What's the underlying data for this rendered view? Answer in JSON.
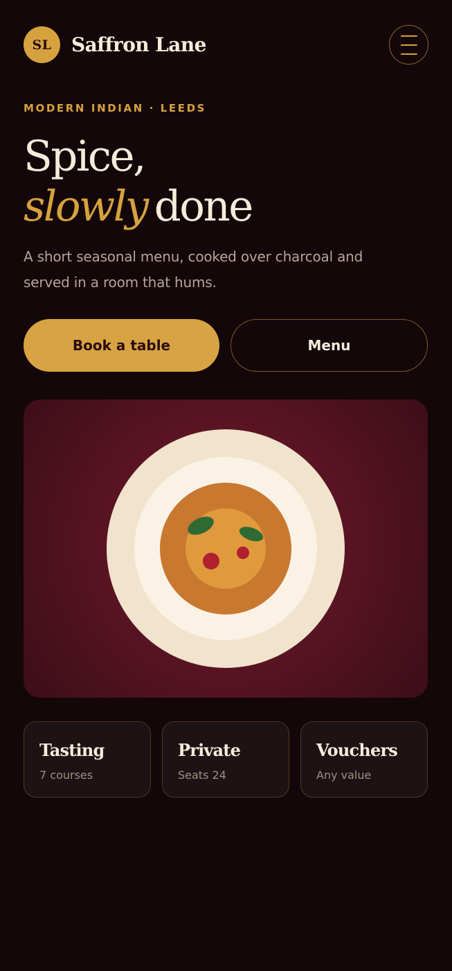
{
  "brand": {
    "logo_initials": "SL",
    "name": "Saffron Lane"
  },
  "header": {
    "menu_icon": "hamburger-menu-icon"
  },
  "hero": {
    "eyebrow": "MODERN INDIAN · LEEDS",
    "headline_line1": "Spice,",
    "headline_accent": "slowly",
    "headline_line2_rest": "done",
    "lead": "A short seasonal menu, cooked over charcoal and served in a room that hums.",
    "image_icon": "curry-plate-illustration"
  },
  "actions": {
    "primary_label": "Book a table",
    "secondary_label": "Menu"
  },
  "cards": [
    {
      "title": "Tasting",
      "subtitle": "7 courses"
    },
    {
      "title": "Private",
      "subtitle": "Seats 24"
    },
    {
      "title": "Vouchers",
      "subtitle": "Any value"
    }
  ],
  "colors": {
    "background": "#140709",
    "accent": "#d6a23f",
    "text": "#f7ecdc",
    "muted": "#b6a49a",
    "hero_panel": "#5a1424"
  }
}
